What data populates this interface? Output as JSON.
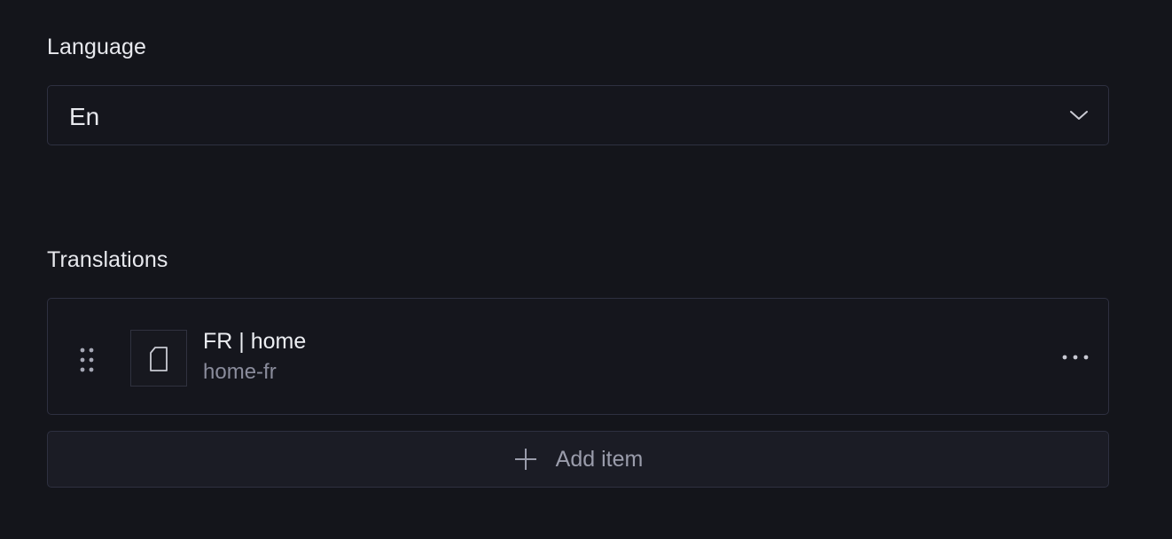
{
  "language_field": {
    "label": "Language",
    "selected_value": "En",
    "icon": "chevron-down-icon"
  },
  "translations_field": {
    "label": "Translations",
    "items": [
      {
        "title": "FR | home",
        "subtitle": "home-fr",
        "thumbnail_icon": "document-icon",
        "handle_icon": "drag-handle-icon",
        "menu_icon": "more-horizontal-icon"
      }
    ],
    "add_button_label": "Add item",
    "add_icon": "plus-icon"
  },
  "colors": {
    "background": "#14151b",
    "border": "#2e3040",
    "text_primary": "#e8e9ee",
    "text_secondary": "#8a8c9c"
  }
}
